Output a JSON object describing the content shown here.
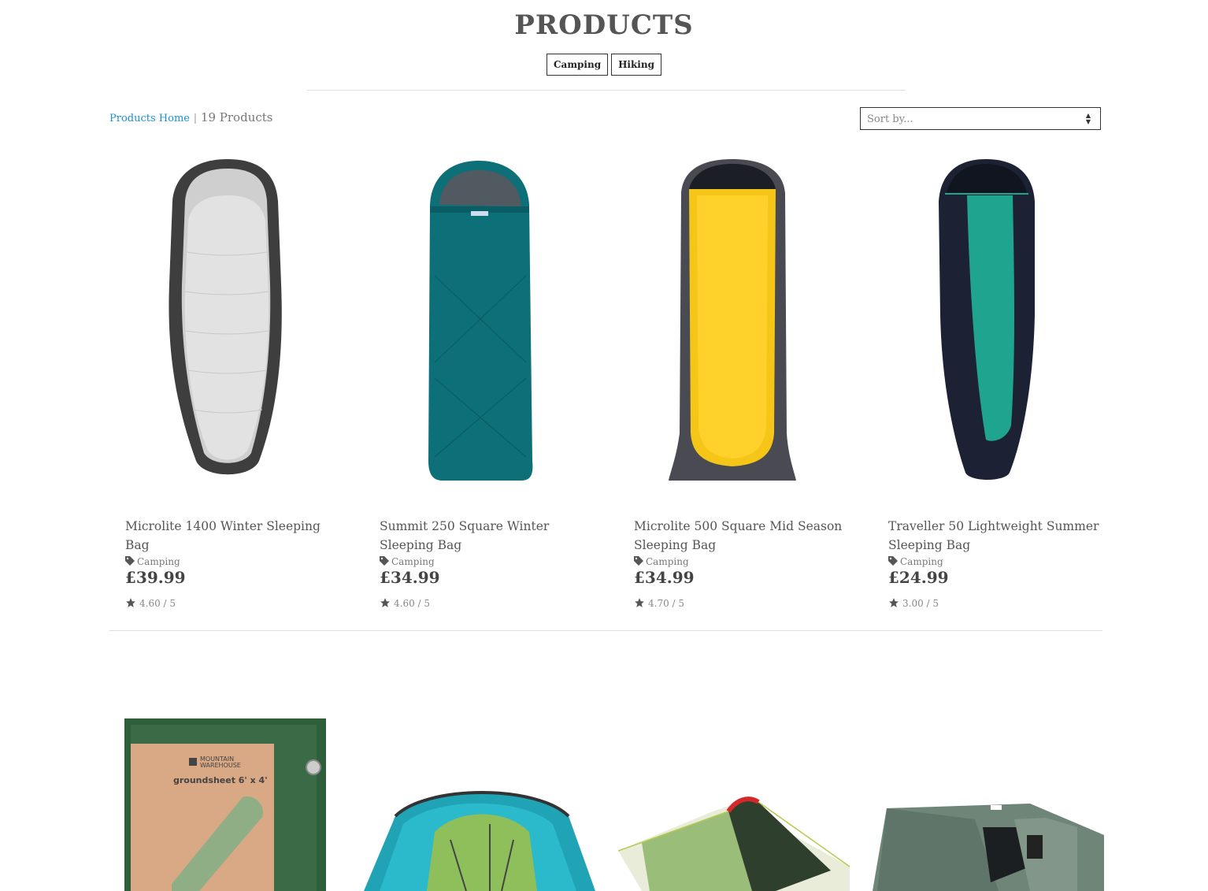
{
  "page_title": "PRODUCTS",
  "categories": [
    "Camping",
    "Hiking"
  ],
  "breadcrumb": {
    "home": "Products Home",
    "separator": "|",
    "count": "19 Products"
  },
  "sort": {
    "placeholder": "Sort by..."
  },
  "products": [
    {
      "name": "Microlite 1400 Winter Sleeping Bag",
      "category": "Camping",
      "price": "£39.99",
      "rating": "4.60 / 5",
      "image": "grey-sleeping-bag-icon"
    },
    {
      "name": "Summit 250 Square Winter Sleeping Bag",
      "category": "Camping",
      "price": "£34.99",
      "rating": "4.60 / 5",
      "image": "teal-sleeping-bag-icon"
    },
    {
      "name": "Microlite 500 Square Mid Season Sleeping Bag",
      "category": "Camping",
      "price": "£34.99",
      "rating": "4.70 / 5",
      "image": "yellow-sleeping-bag-icon"
    },
    {
      "name": "Traveller 50 Lightweight Summer Sleeping Bag",
      "category": "Camping",
      "price": "£24.99",
      "rating": "3.00 / 5",
      "image": "navy-sleeping-bag-icon"
    }
  ],
  "groundsheet": {
    "brand_line1": "MOUNTAIN",
    "brand_line2": "WAREHOUSE",
    "label": "groundsheet 6' x 4'"
  },
  "colors": {
    "link": "#1b8fd6",
    "text": "#555555",
    "border": "#333333"
  }
}
